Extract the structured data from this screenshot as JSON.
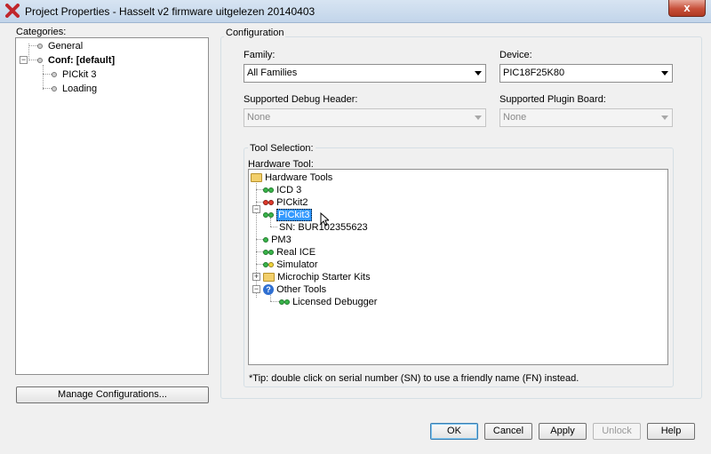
{
  "window": {
    "title": "Project Properties - Hasselt v2 firmware uitgelezen 20140403",
    "close_glyph": "x"
  },
  "categories": {
    "label": "Categories:",
    "items": [
      {
        "label": "General"
      },
      {
        "label": "Conf: [default]"
      },
      {
        "label": "PICkit 3"
      },
      {
        "label": "Loading"
      }
    ],
    "manage_button": "Manage Configurations..."
  },
  "configuration": {
    "group_title": "Configuration",
    "family_label": "Family:",
    "family_value": "All Families",
    "device_label": "Device:",
    "device_value": "PIC18F25K80",
    "debug_header_label": "Supported Debug Header:",
    "debug_header_value": "None",
    "plugin_board_label": "Supported Plugin Board:",
    "plugin_board_value": "None"
  },
  "tool_selection": {
    "group_title": "Tool Selection:",
    "hardware_tool_label": "Hardware Tool:",
    "tree": {
      "root": "Hardware Tools",
      "icd3": "ICD 3",
      "pickit2": "PICkit2",
      "pickit3": "PICkit3",
      "pickit3_serial": "SN: BUR102355623",
      "pm3": "PM3",
      "real_ice": "Real ICE",
      "simulator": "Simulator",
      "starter_kits": "Microchip Starter Kits",
      "other_tools": "Other Tools",
      "licensed_debugger": "Licensed Debugger"
    },
    "tip": "*Tip: double click on serial number (SN) to use a friendly name (FN) instead."
  },
  "buttons": {
    "ok": "OK",
    "cancel": "Cancel",
    "apply": "Apply",
    "unlock": "Unlock",
    "help": "Help"
  },
  "colors": {
    "selection": "#3399ff",
    "status_green": "#39b54a",
    "status_red": "#e0392b",
    "status_yellow": "#f0d33a"
  }
}
